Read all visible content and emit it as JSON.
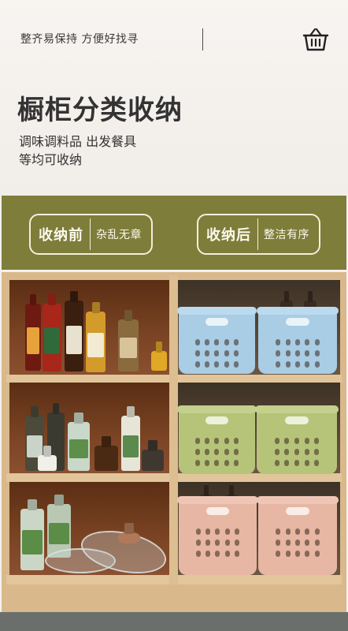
{
  "header": {
    "tagline": "整齐易保持  方便好找寻",
    "icon": "shopping-basket-icon"
  },
  "hero": {
    "title": "橱柜分类收纳",
    "description_line1": "调味调料品 出发餐具",
    "description_line2": "等均可收纳"
  },
  "comparison": {
    "before_label": "收纳前",
    "before_desc": "杂乱无章",
    "after_label": "收纳后",
    "after_desc": "整洁有序"
  },
  "colors": {
    "band": "#7f7d3a",
    "bin_blue": "#a8cde4",
    "bin_green": "#b6c47a",
    "bin_pink": "#e7b7a4",
    "cabinet_wood": "#d9b98c"
  }
}
